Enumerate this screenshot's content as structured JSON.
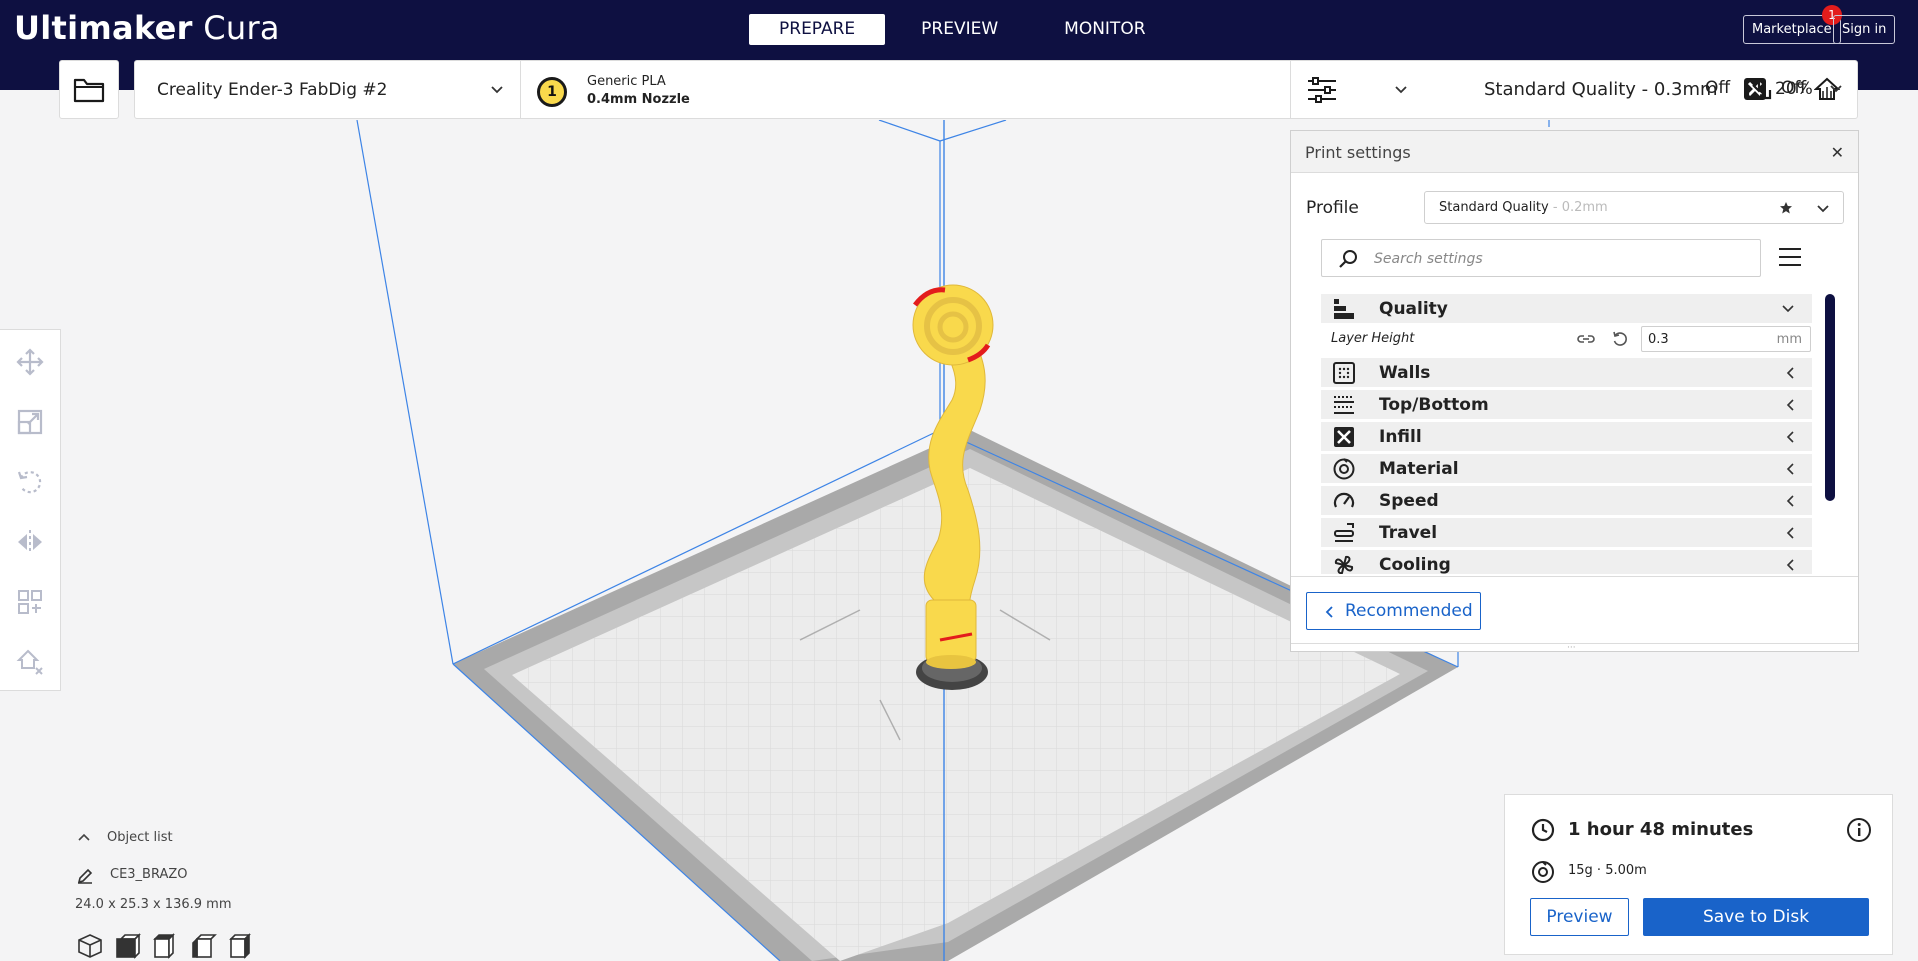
{
  "app": {
    "brand_bold": "Ultimaker",
    "brand_light": "Cura"
  },
  "nav": {
    "tabs": [
      {
        "label": "PREPARE",
        "active": true
      },
      {
        "label": "PREVIEW",
        "active": false
      },
      {
        "label": "MONITOR",
        "active": false
      }
    ],
    "marketplace_label": "Marketplace",
    "marketplace_badge": "1",
    "sign_in_label": "Sign in"
  },
  "printer": {
    "name": "Creality Ender-3 FabDig #2",
    "extruder_number": "1",
    "material": "Generic PLA",
    "nozzle": "0.4mm Nozzle"
  },
  "print_setup": {
    "quality": "Standard Quality - 0.3mm",
    "infill": "20%",
    "support": "Off",
    "adhesion": "Off"
  },
  "print_settings": {
    "title": "Print settings",
    "profile_label": "Profile",
    "profile_value": "Standard Quality",
    "profile_suffix": " - 0.2mm",
    "search_placeholder": "Search settings",
    "categories": [
      {
        "label": "Quality",
        "icon": "quality-icon",
        "expanded": true
      },
      {
        "label": "Walls",
        "icon": "walls-icon",
        "expanded": false
      },
      {
        "label": "Top/Bottom",
        "icon": "top-bottom-icon",
        "expanded": false
      },
      {
        "label": "Infill",
        "icon": "infill-icon",
        "expanded": false
      },
      {
        "label": "Material",
        "icon": "material-icon",
        "expanded": false
      },
      {
        "label": "Speed",
        "icon": "speed-icon",
        "expanded": false
      },
      {
        "label": "Travel",
        "icon": "travel-icon",
        "expanded": false
      },
      {
        "label": "Cooling",
        "icon": "cooling-icon",
        "expanded": false
      }
    ],
    "layer_height": {
      "label": "Layer Height",
      "value": "0.3",
      "unit": "mm"
    },
    "recommended_label": "Recommended"
  },
  "object_list": {
    "toggle_label": "Object list",
    "object_name": "CE3_BRAZO",
    "dimensions": "24.0 x 25.3 x 136.9 mm"
  },
  "summary": {
    "time": "1 hour 48 minutes",
    "material_usage": "15g · 5.00m",
    "preview_label": "Preview",
    "save_label": "Save to Disk"
  },
  "colors": {
    "header_bg": "#0e1041",
    "accent_blue": "#1963c9",
    "model_yellow": "#f9d94c",
    "badge_red": "#e31c1c"
  }
}
